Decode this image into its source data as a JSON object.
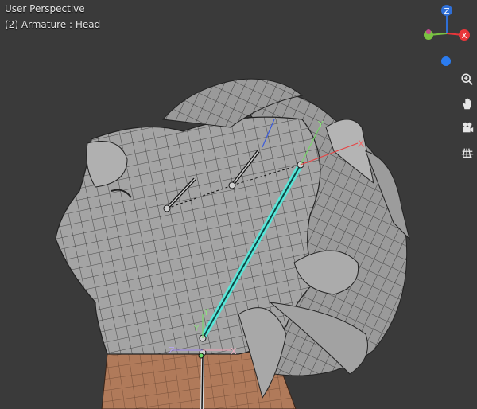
{
  "viewport": {
    "view_name": "User Perspective",
    "object_info": "(2) Armature : Head"
  },
  "gizmo": {
    "axis_z": "Z",
    "axis_x": "X",
    "color_z": "#2f6fd6",
    "color_x": "#e8363a",
    "color_y": "#7ac142",
    "color_extra": "#2b7cf0"
  },
  "bones": {
    "axis_labels": [
      "Y",
      "X",
      "Z",
      "Y",
      "X",
      "Y",
      "Z",
      "X"
    ]
  },
  "nav_tools": [
    {
      "name": "zoom-icon"
    },
    {
      "name": "pan-hand-icon"
    },
    {
      "name": "camera-icon"
    },
    {
      "name": "grid-icon"
    }
  ]
}
